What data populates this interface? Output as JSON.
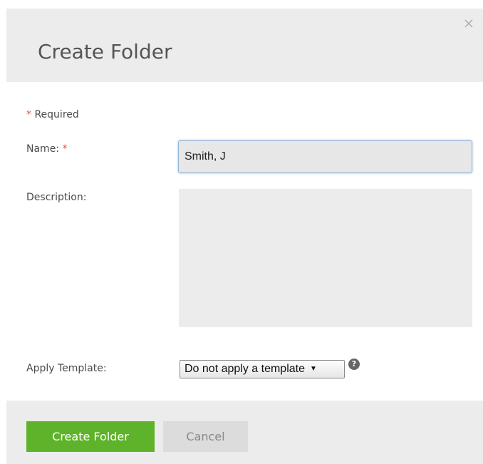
{
  "dialog": {
    "title": "Create Folder",
    "close_icon": "close-icon"
  },
  "form": {
    "required_star": "*",
    "required_text": "Required",
    "name_label": "Name:",
    "name_value": "Smith, J",
    "description_label": "Description:",
    "description_value": "",
    "template_label": "Apply Template:",
    "template_selected": "Do not apply a template",
    "help_icon": "help-icon"
  },
  "footer": {
    "create_label": "Create Folder",
    "cancel_label": "Cancel"
  },
  "colors": {
    "primary_button": "#5fb32a",
    "required_star": "#d9534f",
    "header_background": "#ececec"
  }
}
